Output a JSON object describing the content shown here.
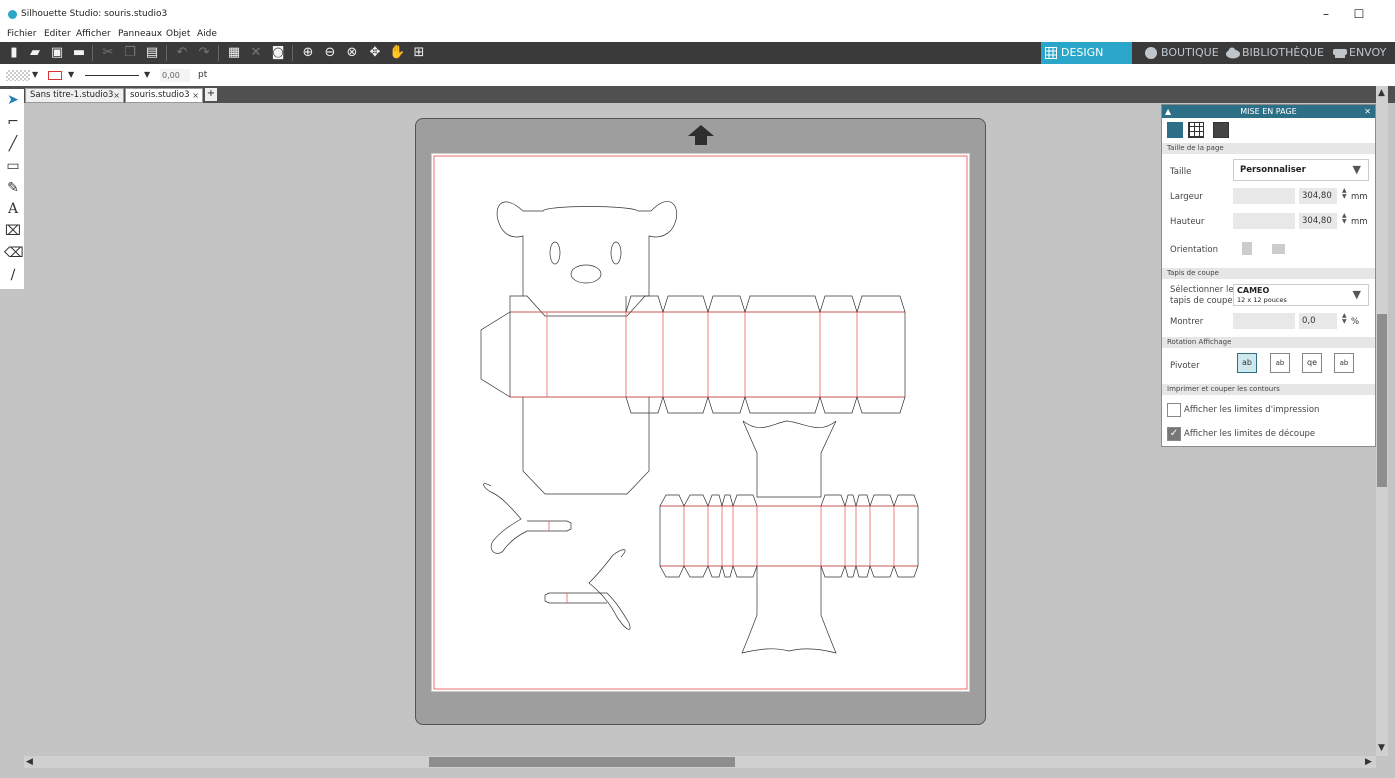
{
  "window": {
    "title": "Silhouette Studio: souris.studio3",
    "minimize": "–",
    "maximize": "☐"
  },
  "menu": [
    "Fichier",
    "Editer",
    "Afficher",
    "Panneaux",
    "Objet",
    "Aide"
  ],
  "modes": {
    "design": "DESIGN",
    "boutique": "BOUTIQUE",
    "bibliotheque": "BIBLIOTHÈQUE",
    "envoyer": "ENVOY"
  },
  "line_options": {
    "thickness": "0,00",
    "unit": "pt"
  },
  "tabs": [
    {
      "label": "Sans titre-1.studio3",
      "close": "×"
    },
    {
      "label": "souris.studio3",
      "close": "×"
    }
  ],
  "add_tab": "+",
  "panel": {
    "title": "MISE EN PAGE",
    "sections": {
      "page_size": "Taille de la page",
      "cutting_mat": "Tapis de coupe",
      "rotation": "Rotation Affichage",
      "print_cut": "Imprimer et couper les contours"
    },
    "size_label": "Taille",
    "size_value": "Personnaliser",
    "width_label": "Largeur",
    "width_value": "304,80",
    "height_label": "Hauteur",
    "height_value": "304,80",
    "unit_mm": "mm",
    "orientation_label": "Orientation",
    "mat_label_line1": "Sélectionner le",
    "mat_label_line2": "tapis de coupe",
    "mat_value": "CAMEO",
    "mat_sub": "12 x 12 pouces",
    "show_label": "Montrer",
    "show_value": "0,0",
    "show_unit": "%",
    "rotate_label": "Pivoter",
    "rotate_options": [
      "ab",
      "ab",
      "qe",
      "ab"
    ],
    "print_limits": "Afficher les limites d'impression",
    "print_limits_checked": false,
    "cut_limits": "Afficher les limites de découpe",
    "cut_limits_checked": true
  },
  "colors": {
    "accent": "#29a6c9",
    "panel_header": "#2c6f86",
    "cut_line": "#e84a4a",
    "toolbar": "#3a3a3a"
  }
}
